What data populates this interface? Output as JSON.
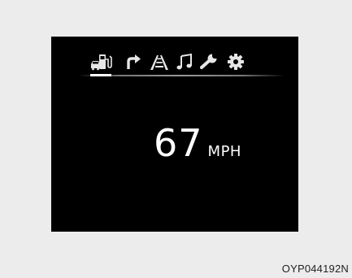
{
  "display": {
    "tabs": [
      {
        "icon": "trip-computer-icon",
        "active": true
      },
      {
        "icon": "turn-by-turn-icon",
        "active": false
      },
      {
        "icon": "lane-assist-icon",
        "active": false
      },
      {
        "icon": "music-icon",
        "active": false
      },
      {
        "icon": "wrench-icon",
        "active": false
      },
      {
        "icon": "settings-gear-icon",
        "active": false
      }
    ],
    "speed_value": "67",
    "speed_unit": "MPH"
  },
  "image_code": "OYP044192N",
  "colors": {
    "screen_background": "#000000",
    "page_background": "#ececec",
    "icon_color": "#e6e6e6",
    "text_color": "#ffffff"
  }
}
